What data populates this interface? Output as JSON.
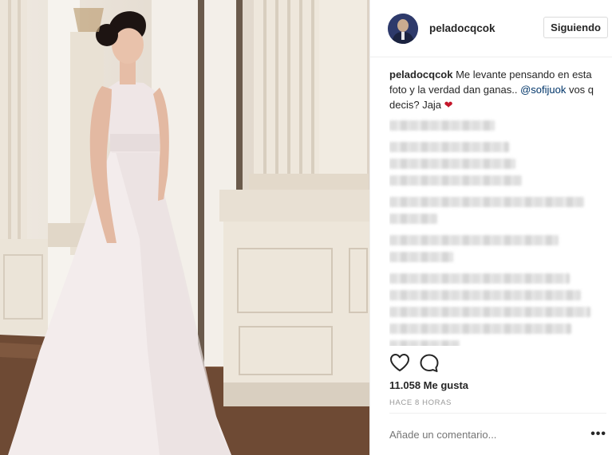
{
  "post": {
    "username": "peladocqcok",
    "follow_label": "Siguiendo",
    "caption": {
      "user": "peladocqcok",
      "text_1": " Me levante pensando en esta foto y la verdad dan ganas.. ",
      "mention": "@sofijuok",
      "text_2": " vos q decis? Jaja ",
      "heart": "❤"
    },
    "likes": "11.058 Me gusta",
    "time": "HACE 8 HORAS",
    "add_comment_placeholder": "Añade un comentario...",
    "more_options": "•••"
  },
  "icons": {
    "heart": "heart-outline-icon",
    "comment": "speech-bubble-icon",
    "more": "ellipsis-icon"
  },
  "colors": {
    "text": "#262626",
    "mention": "#003569",
    "heart_emoji": "#c4162a",
    "muted": "#999999",
    "border": "#dbdbdb"
  }
}
